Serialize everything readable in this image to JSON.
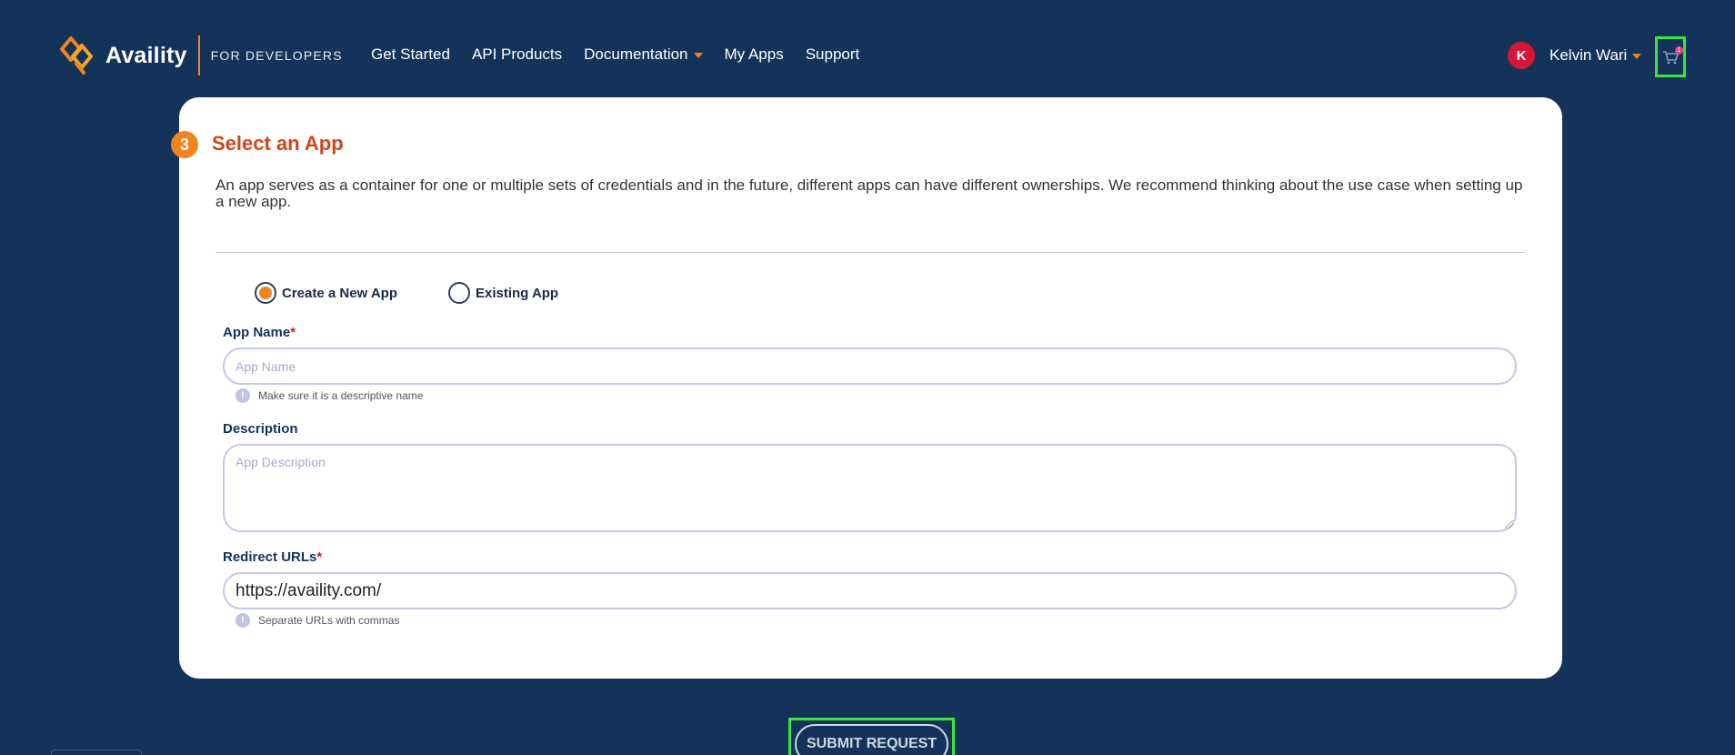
{
  "header": {
    "logo_text": "Availity",
    "logo_sub": "FOR DEVELOPERS",
    "nav": [
      {
        "label": "Get Started"
      },
      {
        "label": "API Products"
      },
      {
        "label": "Documentation",
        "has_dropdown": true
      },
      {
        "label": "My Apps"
      },
      {
        "label": "Support"
      }
    ],
    "user": {
      "initial": "K",
      "name": "Kelvin Wari",
      "avatar_color": "#d41637"
    },
    "cart": {
      "icon": "cart-icon",
      "count": "1"
    }
  },
  "card": {
    "step": "3",
    "title": "Select an App",
    "description": "An app serves as a container for one or multiple sets of credentials and in the future, different apps can have different ownerships. We recommend thinking about the use case when setting up a new app.",
    "options": [
      {
        "label": "Create a New App",
        "checked": true
      },
      {
        "label": "Existing App",
        "checked": false
      }
    ],
    "app_name": {
      "label": "App Name",
      "required": "*",
      "placeholder": "App Name",
      "value": "",
      "hint": "Make sure it is a descriptive name"
    },
    "description_field": {
      "label": "Description",
      "placeholder": "App Description",
      "value": ""
    },
    "redirect": {
      "label": "Redirect URLs",
      "required": "*",
      "value": "https://availity.com/",
      "hint": "Separate URLs with commas"
    }
  },
  "submit": {
    "label": "SUBMIT REQUEST"
  },
  "colors": {
    "background": "#14335a",
    "accent": "#f0851f",
    "title": "#d34419",
    "highlight": "#39e639"
  }
}
